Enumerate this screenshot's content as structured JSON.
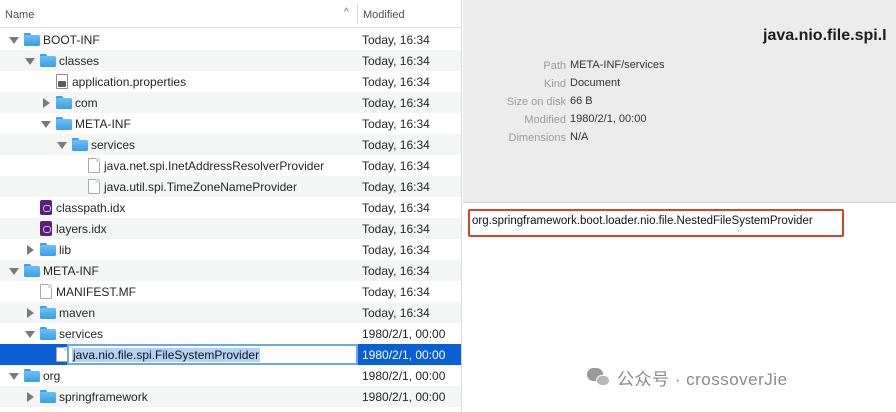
{
  "file_list": {
    "header": {
      "name": "Name",
      "modified": "Modified",
      "sort_glyph": "^"
    },
    "rows": [
      {
        "label": "BOOT-INF",
        "date": "Today, 16:34"
      },
      {
        "label": "classes",
        "date": "Today, 16:34"
      },
      {
        "label": "application.properties",
        "date": "Today, 16:34"
      },
      {
        "label": "com",
        "date": "Today, 16:34"
      },
      {
        "label": "META-INF",
        "date": "Today, 16:34"
      },
      {
        "label": "services",
        "date": "Today, 16:34"
      },
      {
        "label": "java.net.spi.InetAddressResolverProvider",
        "date": "Today, 16:34"
      },
      {
        "label": "java.util.spi.TimeZoneNameProvider",
        "date": "Today, 16:34"
      },
      {
        "label": "classpath.idx",
        "date": "Today, 16:34"
      },
      {
        "label": "layers.idx",
        "date": "Today, 16:34"
      },
      {
        "label": "lib",
        "date": "Today, 16:34"
      },
      {
        "label": "META-INF",
        "date": "Today, 16:34"
      },
      {
        "label": "MANIFEST.MF",
        "date": "Today, 16:34"
      },
      {
        "label": "maven",
        "date": "Today, 16:34"
      },
      {
        "label": "services",
        "date": "1980/2/1, 00:00"
      },
      {
        "label": "java.nio.file.spi.FileSystemProvider",
        "date": "1980/2/1, 00:00"
      },
      {
        "label": "org",
        "date": "1980/2/1, 00:00"
      },
      {
        "label": "springframework",
        "date": "1980/2/1, 00:00"
      }
    ]
  },
  "preview": {
    "title": "java.nio.file.spi.I",
    "info": [
      {
        "key": "Path",
        "value": "META-INF/services"
      },
      {
        "key": "Kind",
        "value": "Document"
      },
      {
        "key": "Size on disk",
        "value": "66 B"
      },
      {
        "key": "Modified",
        "value": "1980/2/1, 00:00"
      },
      {
        "key": "Dimensions",
        "value": "N/A"
      }
    ],
    "content": "org.springframework.boot.loader.nio.file.NestedFileSystemProvider"
  },
  "watermark": "公众号 · crossoverJie",
  "colors": {
    "selection": "#0a5fd6",
    "folder": "#4aa9ee",
    "highlight_box": "#d4442b"
  }
}
